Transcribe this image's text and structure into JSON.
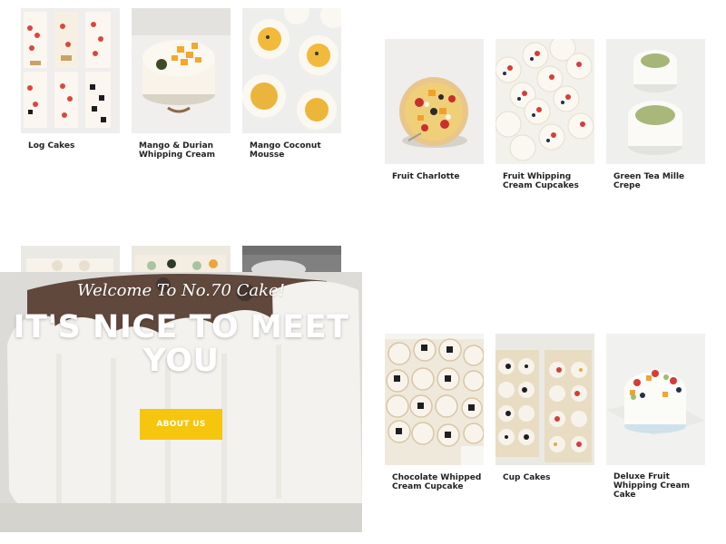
{
  "products": [
    {
      "id": "log",
      "label": "Log Cakes"
    },
    {
      "id": "mango-durian",
      "label": "Mango & Durian Whipping Cream"
    },
    {
      "id": "mango-coconut",
      "label": "Mango Coconut Mousse"
    },
    {
      "id": "fruit-charlotte",
      "label": "Fruit Charlotte"
    },
    {
      "id": "fruit-cupcakes",
      "label": "Fruit Whipping Cream Cupcakes"
    },
    {
      "id": "green-tea",
      "label": "Green Tea Mille Crepe"
    },
    {
      "id": "choc-cupcake",
      "label": "Chocolate Whipped Cream Cupcake"
    },
    {
      "id": "cup-cakes",
      "label": "Cup Cakes"
    },
    {
      "id": "deluxe-fruit",
      "label": "Deluxe Fruit Whipping Cream Cake"
    }
  ],
  "hero": {
    "welcome": "Welcome To No.70 Cake!",
    "headline": "IT'S NICE TO MEET YOU",
    "button": "ABOUT US"
  },
  "colors": {
    "accent": "#f6c50d",
    "label_text": "#222222"
  }
}
